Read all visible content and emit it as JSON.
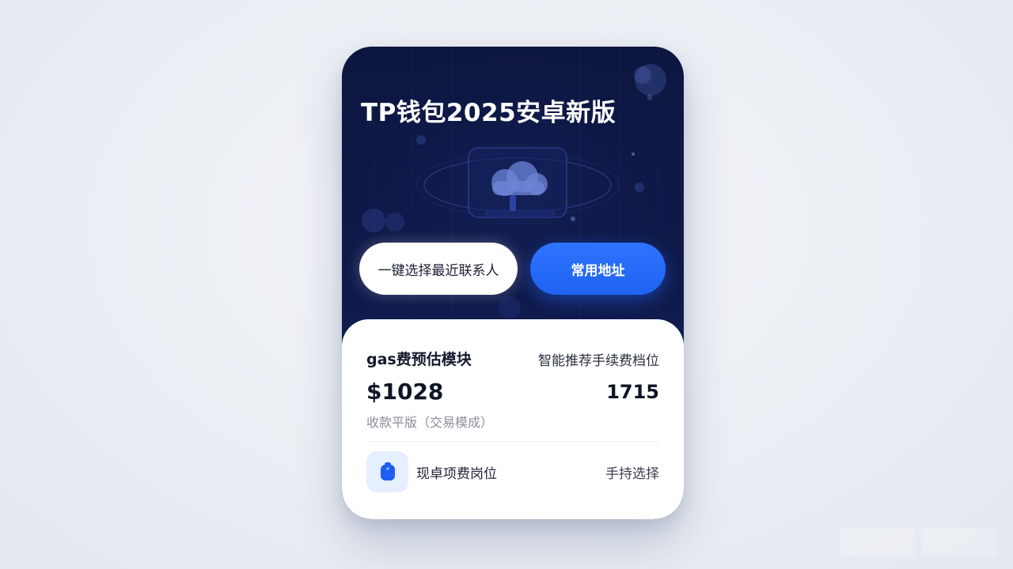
{
  "hero": {
    "title": "TP钱包2025安卓新版"
  },
  "actions": {
    "contacts_label": "一键选择最近联系人",
    "address_label": "常用地址"
  },
  "gas_panel": {
    "title": "gas费预估模块",
    "hint": "智能推荐手续费档位",
    "amount": "$1028",
    "secondary_value": "1715",
    "mode_text": "收款平版（交易模成）",
    "row": {
      "icon": "wallet-icon",
      "label": "现卓项费岗位",
      "action": "手持选择"
    }
  },
  "colors": {
    "hero_background": "#0f1a4a",
    "accent_blue": "#2568ff",
    "panel_background": "#ffffff",
    "icon_tile": "#e6efff"
  }
}
